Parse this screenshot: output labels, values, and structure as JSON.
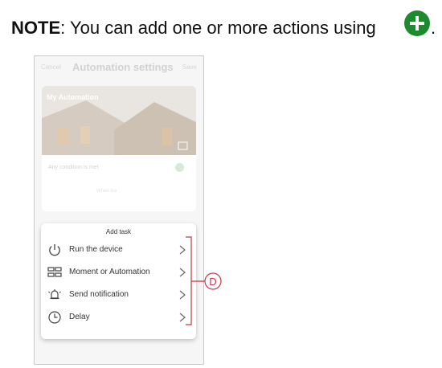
{
  "note": {
    "bold_label": "NOTE",
    "text": ": You can add one or more actions using",
    "period": ".",
    "icon": "plus-circle-icon",
    "icon_color": "#1d8a2e"
  },
  "topbar": {
    "cancel": "Cancel",
    "title": "Automation settings",
    "save": "Save"
  },
  "automation": {
    "name": "My Automation",
    "condition": "Any condition is met",
    "ghost": "When Ice"
  },
  "sheet": {
    "title": "Add task",
    "items": [
      {
        "label": "Run the device",
        "icon": "power-icon"
      },
      {
        "label": "Moment or Automation",
        "icon": "grid-icon"
      },
      {
        "label": "Send notification",
        "icon": "bell-icon"
      },
      {
        "label": "Delay",
        "icon": "clock-icon"
      }
    ]
  },
  "callout": {
    "label": "D",
    "color": "#c8354a"
  }
}
